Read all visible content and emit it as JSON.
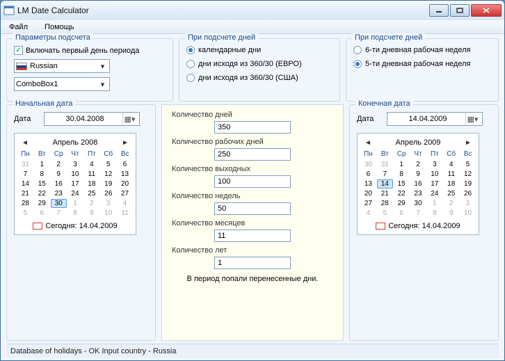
{
  "window": {
    "title": "LM Date Calculator"
  },
  "menu": {
    "file": "Файл",
    "help": "Помощь"
  },
  "params": {
    "title": "Параметры подсчета",
    "include_first_day": "Включать первый день периода",
    "include_first_day_checked": true,
    "lang_selected": "Russian",
    "combo2": "ComboBox1"
  },
  "calc_days1": {
    "title": "При подсчете дней",
    "opt1": "календарные дни",
    "opt2": "дни исходя из 360/30 (ЕВРО)",
    "opt3": "дни исходя из 360/30 (США)",
    "selected": 0
  },
  "calc_days2": {
    "title": "При подсчете дней",
    "opt1": "6-ти дневная рабочая неделя",
    "opt2": "5-ти дневная рабочая неделя",
    "selected": 1
  },
  "start": {
    "title": "Начальная дата",
    "date_label": "Дата",
    "date_value": "30.04.2008",
    "month": "Апрель 2008",
    "dow": [
      "Пн",
      "Вт",
      "Ср",
      "Чт",
      "Пт",
      "Сб",
      "Вс"
    ],
    "days": [
      {
        "n": "31",
        "o": true
      },
      {
        "n": "1"
      },
      {
        "n": "2"
      },
      {
        "n": "3"
      },
      {
        "n": "4"
      },
      {
        "n": "5"
      },
      {
        "n": "6"
      },
      {
        "n": "7"
      },
      {
        "n": "8"
      },
      {
        "n": "9"
      },
      {
        "n": "10"
      },
      {
        "n": "11"
      },
      {
        "n": "12"
      },
      {
        "n": "13"
      },
      {
        "n": "14"
      },
      {
        "n": "15"
      },
      {
        "n": "16"
      },
      {
        "n": "17"
      },
      {
        "n": "18"
      },
      {
        "n": "19"
      },
      {
        "n": "20"
      },
      {
        "n": "21"
      },
      {
        "n": "22"
      },
      {
        "n": "23"
      },
      {
        "n": "24"
      },
      {
        "n": "25"
      },
      {
        "n": "26"
      },
      {
        "n": "27"
      },
      {
        "n": "28"
      },
      {
        "n": "29"
      },
      {
        "n": "30",
        "s": true
      },
      {
        "n": "1",
        "o": true
      },
      {
        "n": "2",
        "o": true
      },
      {
        "n": "3",
        "o": true
      },
      {
        "n": "4",
        "o": true
      },
      {
        "n": "5",
        "o": true
      },
      {
        "n": "6",
        "o": true
      },
      {
        "n": "7",
        "o": true
      },
      {
        "n": "8",
        "o": true
      },
      {
        "n": "9",
        "o": true
      },
      {
        "n": "10",
        "o": true
      },
      {
        "n": "11",
        "o": true
      }
    ],
    "today": "Сегодня: 14.04.2009"
  },
  "end": {
    "title": "Конечная дата",
    "date_label": "Дата",
    "date_value": "14.04.2009",
    "month": "Апрель 2009",
    "dow": [
      "Пн",
      "Вт",
      "Ср",
      "Чт",
      "Пт",
      "Сб",
      "Вс"
    ],
    "days": [
      {
        "n": "30",
        "o": true
      },
      {
        "n": "31",
        "o": true
      },
      {
        "n": "1"
      },
      {
        "n": "2"
      },
      {
        "n": "3"
      },
      {
        "n": "4"
      },
      {
        "n": "5"
      },
      {
        "n": "6"
      },
      {
        "n": "7"
      },
      {
        "n": "8"
      },
      {
        "n": "9"
      },
      {
        "n": "10"
      },
      {
        "n": "11"
      },
      {
        "n": "12"
      },
      {
        "n": "13"
      },
      {
        "n": "14",
        "s": true
      },
      {
        "n": "15"
      },
      {
        "n": "16"
      },
      {
        "n": "17"
      },
      {
        "n": "18"
      },
      {
        "n": "19"
      },
      {
        "n": "20"
      },
      {
        "n": "21"
      },
      {
        "n": "22"
      },
      {
        "n": "23"
      },
      {
        "n": "24"
      },
      {
        "n": "25"
      },
      {
        "n": "26"
      },
      {
        "n": "27"
      },
      {
        "n": "28"
      },
      {
        "n": "29"
      },
      {
        "n": "30"
      },
      {
        "n": "1",
        "o": true
      },
      {
        "n": "2",
        "o": true
      },
      {
        "n": "3",
        "o": true
      },
      {
        "n": "4",
        "o": true
      },
      {
        "n": "5",
        "o": true
      },
      {
        "n": "6",
        "o": true
      },
      {
        "n": "7",
        "o": true
      },
      {
        "n": "8",
        "o": true
      },
      {
        "n": "9",
        "o": true
      },
      {
        "n": "10",
        "o": true
      }
    ],
    "today": "Сегодня: 14.04.2009"
  },
  "results": {
    "days_label": "Количество дней",
    "days": "350",
    "workdays_label": "Количество рабочих дней",
    "workdays": "250",
    "weekends_label": "Количество выходных",
    "weekends": "100",
    "weeks_label": "Количество недель",
    "weeks": "50",
    "months_label": "Количество месяцев",
    "months": "11",
    "years_label": "Количество лет",
    "years": "1",
    "note": "В период попали перенесенные дни."
  },
  "status": "Database of holidays - OK Input country - Russia"
}
